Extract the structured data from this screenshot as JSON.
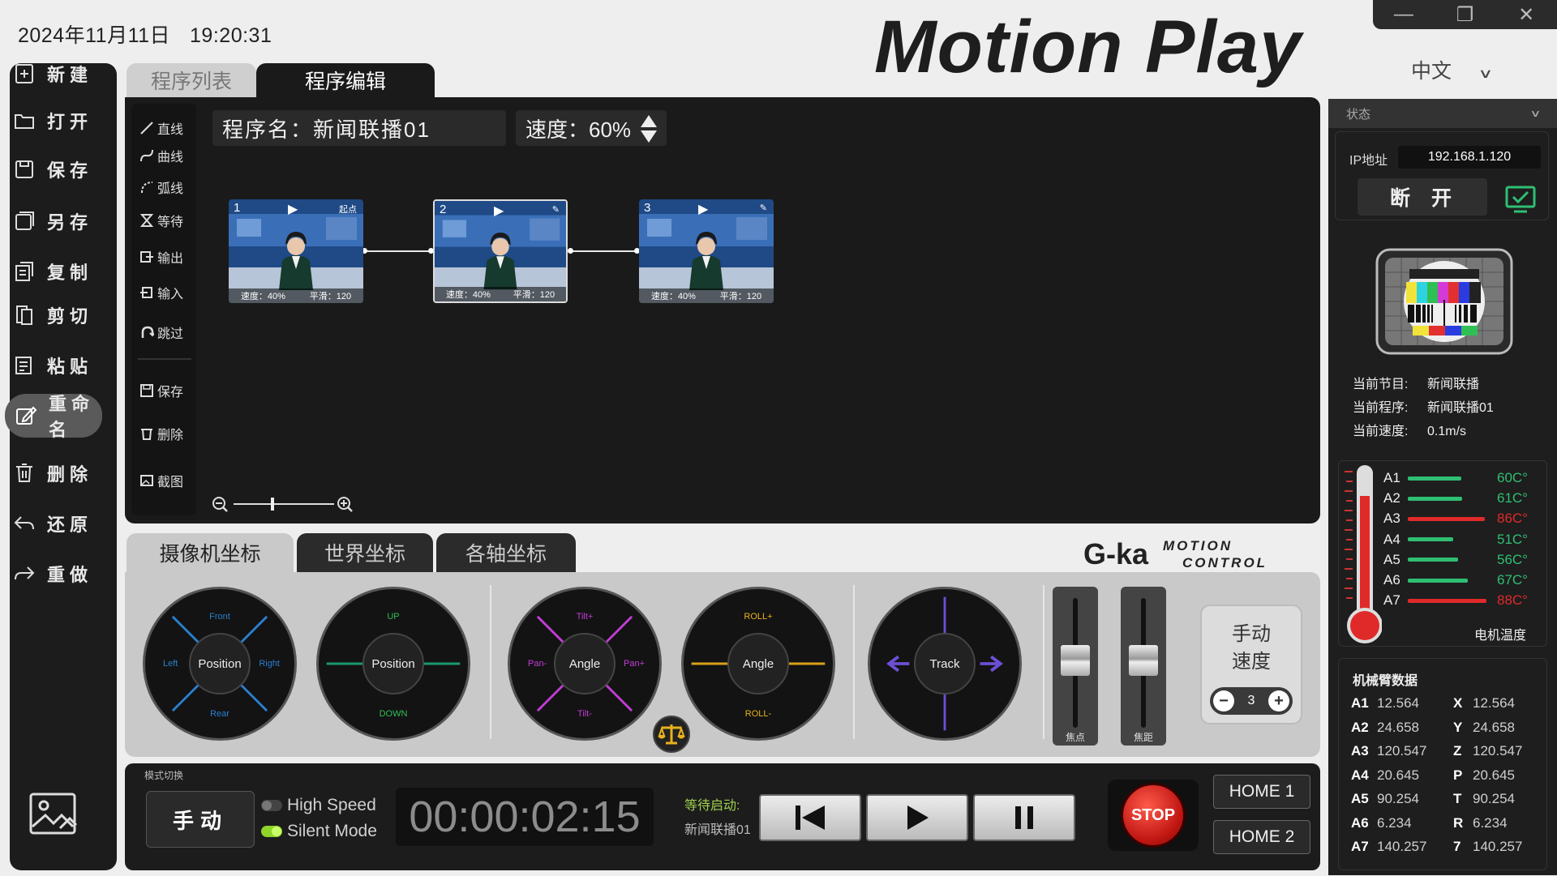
{
  "header": {
    "date": "2024年11月11日",
    "time": "19:20:31",
    "brand": "Motion Play",
    "language": "中文"
  },
  "sidebar": {
    "items": [
      {
        "label": "新建",
        "icon": "new-file-icon"
      },
      {
        "label": "打开",
        "icon": "folder-open-icon"
      },
      {
        "label": "保存",
        "icon": "save-icon"
      },
      {
        "label": "另存",
        "icon": "save-as-icon"
      },
      {
        "label": "复制",
        "icon": "copy-icon"
      },
      {
        "label": "剪切",
        "icon": "cut-icon"
      },
      {
        "label": "粘贴",
        "icon": "paste-icon"
      },
      {
        "label": "重命名",
        "icon": "rename-icon",
        "active": true
      },
      {
        "label": "删除",
        "icon": "trash-icon"
      },
      {
        "label": "还原",
        "icon": "undo-icon"
      },
      {
        "label": "重做",
        "icon": "redo-icon"
      }
    ]
  },
  "tabs": {
    "program_list": "程序列表",
    "program_edit": "程序编辑"
  },
  "editor": {
    "program_name": "程序名：新闻联播01",
    "speed": "速度：60%",
    "tools": [
      "直线",
      "曲线",
      "弧线",
      "等待",
      "输出",
      "输入",
      "跳过",
      "保存",
      "删除",
      "截图"
    ],
    "nodes": [
      {
        "num": "1",
        "label": "起点",
        "speed": "速度：40%",
        "smooth": "平滑：120"
      },
      {
        "num": "2",
        "label": "",
        "speed": "速度：40%",
        "smooth": "平滑：120"
      },
      {
        "num": "3",
        "label": "",
        "speed": "速度：40%",
        "smooth": "平滑：120"
      }
    ]
  },
  "coord_tabs": {
    "camera": "摄像机坐标",
    "world": "世界坐标",
    "axes": "各轴坐标"
  },
  "gka_logo": {
    "left": "G-ka",
    "right_top": "MOTION",
    "right_bottom": "CONTROL"
  },
  "joysticks": [
    {
      "center": "Position",
      "top": "Front",
      "bottom": "Rear",
      "left": "Left",
      "right": "Right",
      "color": "#2a7fd0"
    },
    {
      "center": "Position",
      "top": "UP",
      "bottom": "DOWN",
      "color": "#1a9a6a"
    },
    {
      "center": "Angle",
      "top": "Tilt+",
      "bottom": "Tilt-",
      "left": "Pan-",
      "right": "Pan+",
      "color": "#c33dd6"
    },
    {
      "center": "Angle",
      "top": "ROLL+",
      "bottom": "ROLL-",
      "color": "#d9a21a"
    },
    {
      "center": "Track",
      "color": "#6c4fd6"
    }
  ],
  "faders": {
    "focus": "焦点",
    "zoom": "焦距"
  },
  "manual_speed": {
    "title_line1": "手动",
    "title_line2": "速度",
    "value": "3"
  },
  "bottom": {
    "mode_caption": "模式切换",
    "manual_button": "手动",
    "high_speed": "High Speed",
    "silent_mode": "Silent Mode",
    "timer": "00:00:02:15",
    "wait_label": "等待启动:",
    "wait_value": "新闻联播01",
    "stop": "STOP",
    "home1": "HOME 1",
    "home2": "HOME 2"
  },
  "status_panel": {
    "title": "状态",
    "ip_label": "IP地址",
    "ip_value": "192.168.1.120",
    "disconnect": "断开",
    "current_program_label": "当前节目:",
    "current_program": "新闻联播",
    "current_procedure_label": "当前程序:",
    "current_procedure": "新闻联播01",
    "current_speed_label": "当前速度:",
    "current_speed": "0.1m/s",
    "temps": [
      {
        "name": "A1",
        "value": "60C°",
        "level": 0.6,
        "color": "#2fbf73"
      },
      {
        "name": "A2",
        "value": "61C°",
        "level": 0.61,
        "color": "#2fbf73"
      },
      {
        "name": "A3",
        "value": "86C°",
        "level": 0.86,
        "color": "#e02a2a"
      },
      {
        "name": "A4",
        "value": "51C°",
        "level": 0.51,
        "color": "#2fbf73"
      },
      {
        "name": "A5",
        "value": "56C°",
        "level": 0.56,
        "color": "#2fbf73"
      },
      {
        "name": "A6",
        "value": "67C°",
        "level": 0.67,
        "color": "#2fbf73"
      },
      {
        "name": "A7",
        "value": "88C°",
        "level": 0.88,
        "color": "#e02a2a"
      }
    ],
    "motor_temp_label": "电机温度",
    "arm_title": "机械臂数据",
    "arm": [
      {
        "k": "A1",
        "v": "12.564",
        "k2": "X",
        "v2": "12.564"
      },
      {
        "k": "A2",
        "v": "24.658",
        "k2": "Y",
        "v2": "24.658"
      },
      {
        "k": "A3",
        "v": "120.547",
        "k2": "Z",
        "v2": "120.547"
      },
      {
        "k": "A4",
        "v": "20.645",
        "k2": "P",
        "v2": "20.645"
      },
      {
        "k": "A5",
        "v": "90.254",
        "k2": "T",
        "v2": "90.254"
      },
      {
        "k": "A6",
        "v": "6.234",
        "k2": "R",
        "v2": "6.234"
      },
      {
        "k": "A7",
        "v": "140.257",
        "k2": "7",
        "v2": "140.257"
      }
    ]
  }
}
